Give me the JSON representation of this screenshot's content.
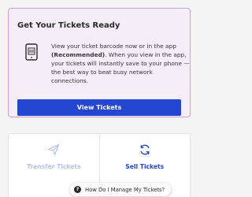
{
  "ready": {
    "title": "Get Your Tickets Ready",
    "body_pre": "View your ticket barcode now or in the app ",
    "body_bold": "(Recommended)",
    "body_post": ". When you view in the app, your tickets will instantly save to your phone — the best way to beat busy network connections.",
    "icon": "phone-icon",
    "button_label": "View Tickets"
  },
  "actions": [
    {
      "label": "Transfer Tickets",
      "icon": "send-icon",
      "enabled": false
    },
    {
      "label": "Sell Tickets",
      "icon": "refresh-icon",
      "enabled": true
    }
  ],
  "help": {
    "icon": "question-icon",
    "icon_glyph": "?",
    "label": "How Do I Manage My Tickets?"
  },
  "colors": {
    "accent": "#2347d1",
    "card_background": "#f5eef9",
    "card_border": "#c89fdb",
    "disabled_text": "#b6c3ec"
  }
}
